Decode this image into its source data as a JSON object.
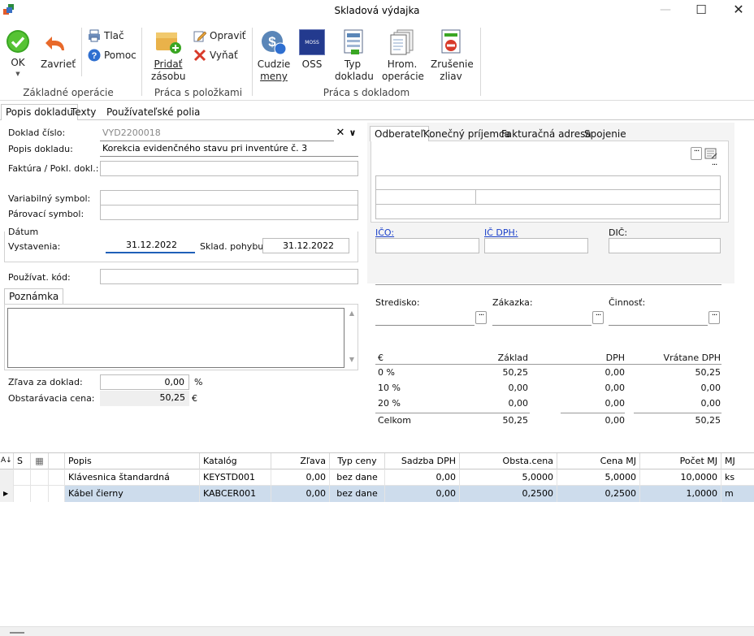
{
  "window": {
    "title": "Skladová výdajka",
    "minimize": "—",
    "maximize": "☐",
    "close": "✕"
  },
  "ribbon": {
    "ok": "OK",
    "close": "Zavrieť",
    "print": "Tlač",
    "help": "Pomoc",
    "group_basic": "Základné operácie",
    "add_stock_1": "Pridať",
    "add_stock_2": "zásobu",
    "edit": "Opraviť",
    "remove": "Vyňať",
    "group_items": "Práca s položkami",
    "foreign_1": "Cudzie",
    "foreign_2": "meny",
    "oss": "OSS",
    "oss_badge": "MOSS",
    "type_1": "Typ",
    "type_2": "dokladu",
    "bulk_1": "Hrom.",
    "bulk_2": "operácie",
    "cancel_1": "Zrušenie",
    "cancel_2": "zliav",
    "group_doc": "Práca s dokladom"
  },
  "tabs": [
    "Popis dokladu",
    "Texty",
    "Používateľské polia"
  ],
  "form": {
    "doc_number_label": "Doklad číslo:",
    "doc_number": "VYD2200018",
    "doc_desc_label": "Popis dokladu:",
    "doc_desc": "Korekcia evidenčného stavu pri inventúre č. 3",
    "invoice_label": "Faktúra / Pokl. dokl.:",
    "invoice": "",
    "var_symbol_label": "Variabilný symbol:",
    "var_symbol": "",
    "pair_symbol_label": "Párovací symbol:",
    "pair_symbol": "",
    "date_group": "Dátum",
    "issued_label": "Vystavenia:",
    "issued": "31.12.2022",
    "move_label": "Sklad. pohybu:",
    "move_date": "31.12.2022",
    "user_code_label": "Používat. kód:",
    "user_code": "",
    "note_tab": "Poznámka",
    "note": "",
    "discount_label": "Zľava za doklad:",
    "discount": "0,00",
    "discount_unit": "%",
    "cost_label": "Obstarávacia cena:",
    "cost": "50,25",
    "cost_unit": "€"
  },
  "partner_tabs": [
    "Odberateľ",
    "Konečný príjemca",
    "Fakturačná adresa",
    "Spojenie"
  ],
  "partner": {
    "ico_label": "IČO:",
    "icdph_label": "IČ DPH:",
    "dic_label": "DIČ:",
    "center_label": "Stredisko:",
    "order_label": "Zákazka:",
    "activity_label": "Činnosť:"
  },
  "vat_table": {
    "headers": [
      "€",
      "Základ",
      "DPH",
      "Vrátane DPH"
    ],
    "rows": [
      [
        "0 %",
        "50,25",
        "0,00",
        "50,25"
      ],
      [
        "10 %",
        "0,00",
        "0,00",
        "0,00"
      ],
      [
        "20 %",
        "0,00",
        "0,00",
        "0,00"
      ]
    ],
    "total": [
      "Celkom",
      "50,25",
      "0,00",
      "50,25"
    ]
  },
  "grid": {
    "headers": [
      "S",
      "Popis",
      "Katalóg",
      "Zľava",
      "Typ ceny",
      "Sadzba DPH",
      "Obsta.cena",
      "Cena MJ",
      "Počet MJ",
      "MJ"
    ],
    "rows": [
      [
        "Klávesnica štandardná",
        "KEYSTD001",
        "0,00",
        "bez dane",
        "0,00",
        "5,0000",
        "5,0000",
        "10,0000",
        "ks"
      ],
      [
        "Kábel čierny",
        "KABCER001",
        "0,00",
        "bez dane",
        "0,00",
        "0,2500",
        "0,2500",
        "1,0000",
        "m"
      ]
    ]
  }
}
